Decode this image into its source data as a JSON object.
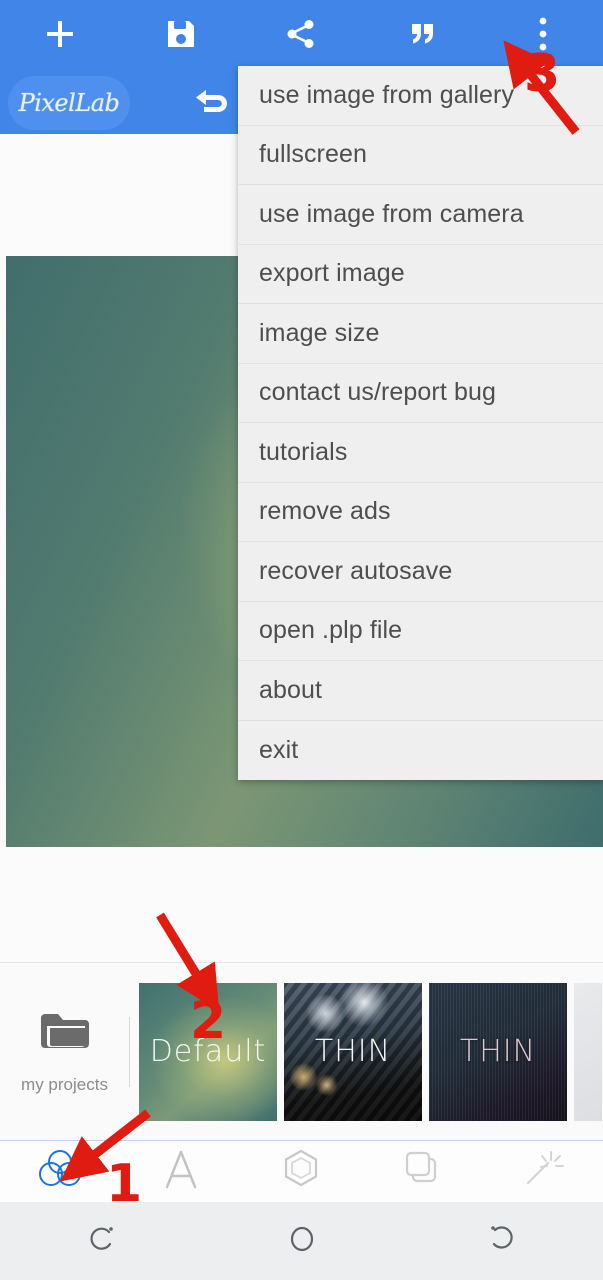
{
  "app": {
    "name": "PixelLab",
    "accent_color": "#4285e8",
    "annotation_color": "#e01b10"
  },
  "topbar": {
    "logo_text": "PixelLab",
    "buttons": [
      {
        "name": "add-button",
        "icon": "plus-icon"
      },
      {
        "name": "save-button",
        "icon": "floppy-disk-icon"
      },
      {
        "name": "share-button",
        "icon": "share-icon"
      },
      {
        "name": "quote-button",
        "icon": "quote-icon"
      },
      {
        "name": "overflow-menu-button",
        "icon": "three-dots-vertical-icon"
      }
    ],
    "undo": {
      "name": "undo-button",
      "icon": "undo-arrow-icon"
    }
  },
  "menu": {
    "items": [
      {
        "label": "use image from gallery"
      },
      {
        "label": "fullscreen"
      },
      {
        "label": "use image from camera"
      },
      {
        "label": "export image"
      },
      {
        "label": "image size"
      },
      {
        "label": "contact us/report bug"
      },
      {
        "label": "tutorials"
      },
      {
        "label": "remove ads"
      },
      {
        "label": "recover autosave"
      },
      {
        "label": "open .plp file"
      },
      {
        "label": "about"
      },
      {
        "label": "exit"
      }
    ]
  },
  "template_strip": {
    "my_projects_label": "my projects",
    "my_projects_icon": "folder-icon",
    "thumbnails": [
      {
        "label": "Default",
        "style": "t-default"
      },
      {
        "label": "THIN",
        "style": "t-thin1"
      },
      {
        "label": "THIN",
        "style": "t-thin2"
      },
      {
        "label": "",
        "style": "t-partial"
      }
    ]
  },
  "tabbar": {
    "tabs": [
      {
        "name": "tab-background",
        "icon": "three-circles-icon",
        "active": true
      },
      {
        "name": "tab-text",
        "icon": "letter-a-icon",
        "active": false
      },
      {
        "name": "tab-shape",
        "icon": "hexagon-icon",
        "active": false
      },
      {
        "name": "tab-layers",
        "icon": "layers-icon",
        "active": false
      },
      {
        "name": "tab-effects",
        "icon": "magic-wand-icon",
        "active": false
      }
    ]
  },
  "navbar": {
    "buttons": [
      {
        "name": "nav-recents-button",
        "icon": "recents-icon"
      },
      {
        "name": "nav-home-button",
        "icon": "home-circle-icon"
      },
      {
        "name": "nav-back-button",
        "icon": "back-icon"
      }
    ]
  },
  "annotations": {
    "step1": "1",
    "step2": "2",
    "step3": "3"
  }
}
